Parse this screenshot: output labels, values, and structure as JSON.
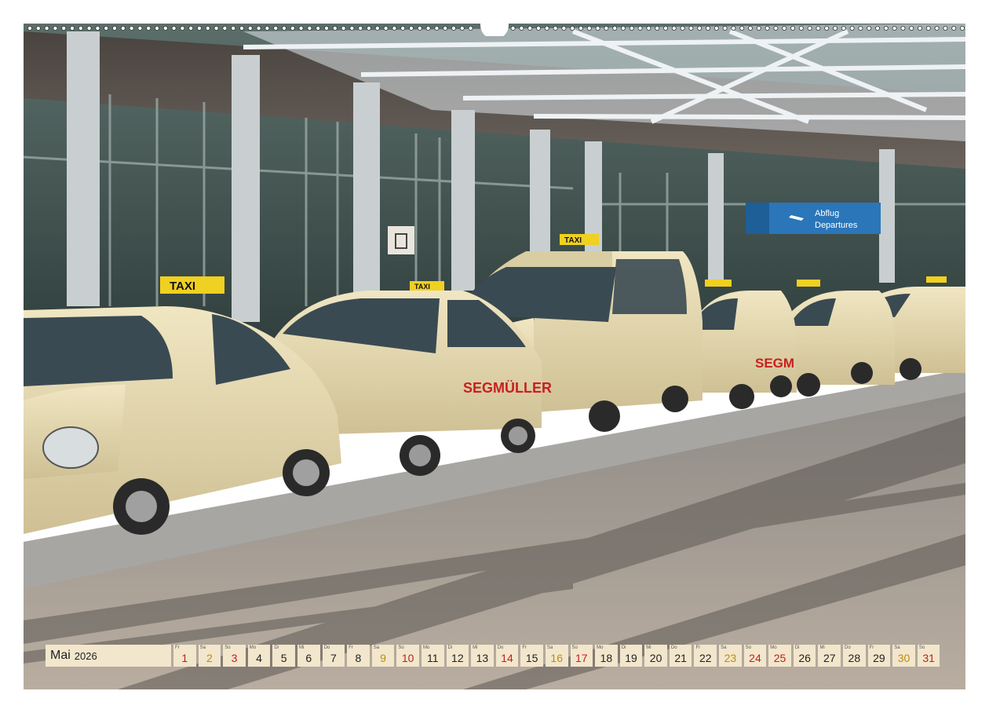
{
  "calendar": {
    "month": "Mai",
    "year": "2026",
    "days": [
      {
        "n": "1",
        "d": "Fr",
        "t": "hol"
      },
      {
        "n": "2",
        "d": "Sa",
        "t": "sat"
      },
      {
        "n": "3",
        "d": "So",
        "t": "sun"
      },
      {
        "n": "4",
        "d": "Mo",
        "t": ""
      },
      {
        "n": "5",
        "d": "Di",
        "t": ""
      },
      {
        "n": "6",
        "d": "Mi",
        "t": ""
      },
      {
        "n": "7",
        "d": "Do",
        "t": ""
      },
      {
        "n": "8",
        "d": "Fr",
        "t": ""
      },
      {
        "n": "9",
        "d": "Sa",
        "t": "sat"
      },
      {
        "n": "10",
        "d": "So",
        "t": "sun"
      },
      {
        "n": "11",
        "d": "Mo",
        "t": ""
      },
      {
        "n": "12",
        "d": "Di",
        "t": ""
      },
      {
        "n": "13",
        "d": "Mi",
        "t": ""
      },
      {
        "n": "14",
        "d": "Do",
        "t": "hol"
      },
      {
        "n": "15",
        "d": "Fr",
        "t": ""
      },
      {
        "n": "16",
        "d": "Sa",
        "t": "sat"
      },
      {
        "n": "17",
        "d": "So",
        "t": "sun"
      },
      {
        "n": "18",
        "d": "Mo",
        "t": ""
      },
      {
        "n": "19",
        "d": "Di",
        "t": ""
      },
      {
        "n": "20",
        "d": "Mi",
        "t": ""
      },
      {
        "n": "21",
        "d": "Do",
        "t": ""
      },
      {
        "n": "22",
        "d": "Fr",
        "t": ""
      },
      {
        "n": "23",
        "d": "Sa",
        "t": "sat"
      },
      {
        "n": "24",
        "d": "So",
        "t": "sun"
      },
      {
        "n": "25",
        "d": "Mo",
        "t": "hol"
      },
      {
        "n": "26",
        "d": "Di",
        "t": ""
      },
      {
        "n": "27",
        "d": "Mi",
        "t": ""
      },
      {
        "n": "28",
        "d": "Do",
        "t": ""
      },
      {
        "n": "29",
        "d": "Fr",
        "t": ""
      },
      {
        "n": "30",
        "d": "Sa",
        "t": "sat"
      },
      {
        "n": "31",
        "d": "So",
        "t": "sun"
      }
    ]
  },
  "photo": {
    "sign_line1": "Abflug",
    "sign_line2": "Departures",
    "taxi_label": "TAXI",
    "ad_text": "SEGMÜLLER",
    "ad_text_short": "SEGM"
  },
  "colors": {
    "taxi_ivory": "#e8dcae",
    "sign_blue": "#2a76b8",
    "sunday_red": "#c02020",
    "saturday_gold": "#c08a10",
    "cell_bg": "#f2e6cc"
  }
}
